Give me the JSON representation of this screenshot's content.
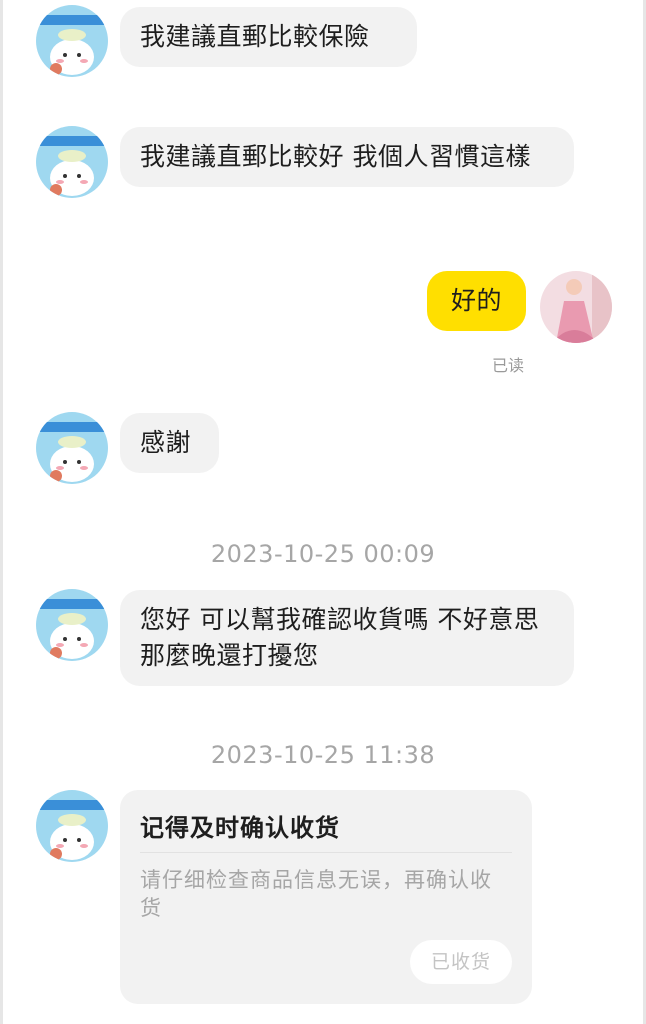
{
  "messages": [
    {
      "text": "我建議直郵比較保險"
    },
    {
      "text": "我建議直郵比較好 我個人習慣這樣"
    },
    {
      "text": "好的",
      "status": "已读"
    },
    {
      "text": "感謝"
    },
    {
      "text": "您好 可以幫我確認收貨嗎 不好意思那麼晚還打擾您"
    }
  ],
  "timestamps": [
    "2023-10-25 00:09",
    "2023-10-25 11:38"
  ],
  "card": {
    "title": "记得及时确认收货",
    "description": "请仔细检查商品信息无误，再确认收货",
    "button_label": "已收货"
  },
  "colors": {
    "my_bubble": "#ffdf00",
    "other_bubble": "#f2f2f2",
    "timestamp_text": "#a6a6a6"
  },
  "icons": {
    "seller_avatar": "cartoon-cat-avatar",
    "my_avatar": "pink-dress-photo-avatar"
  }
}
